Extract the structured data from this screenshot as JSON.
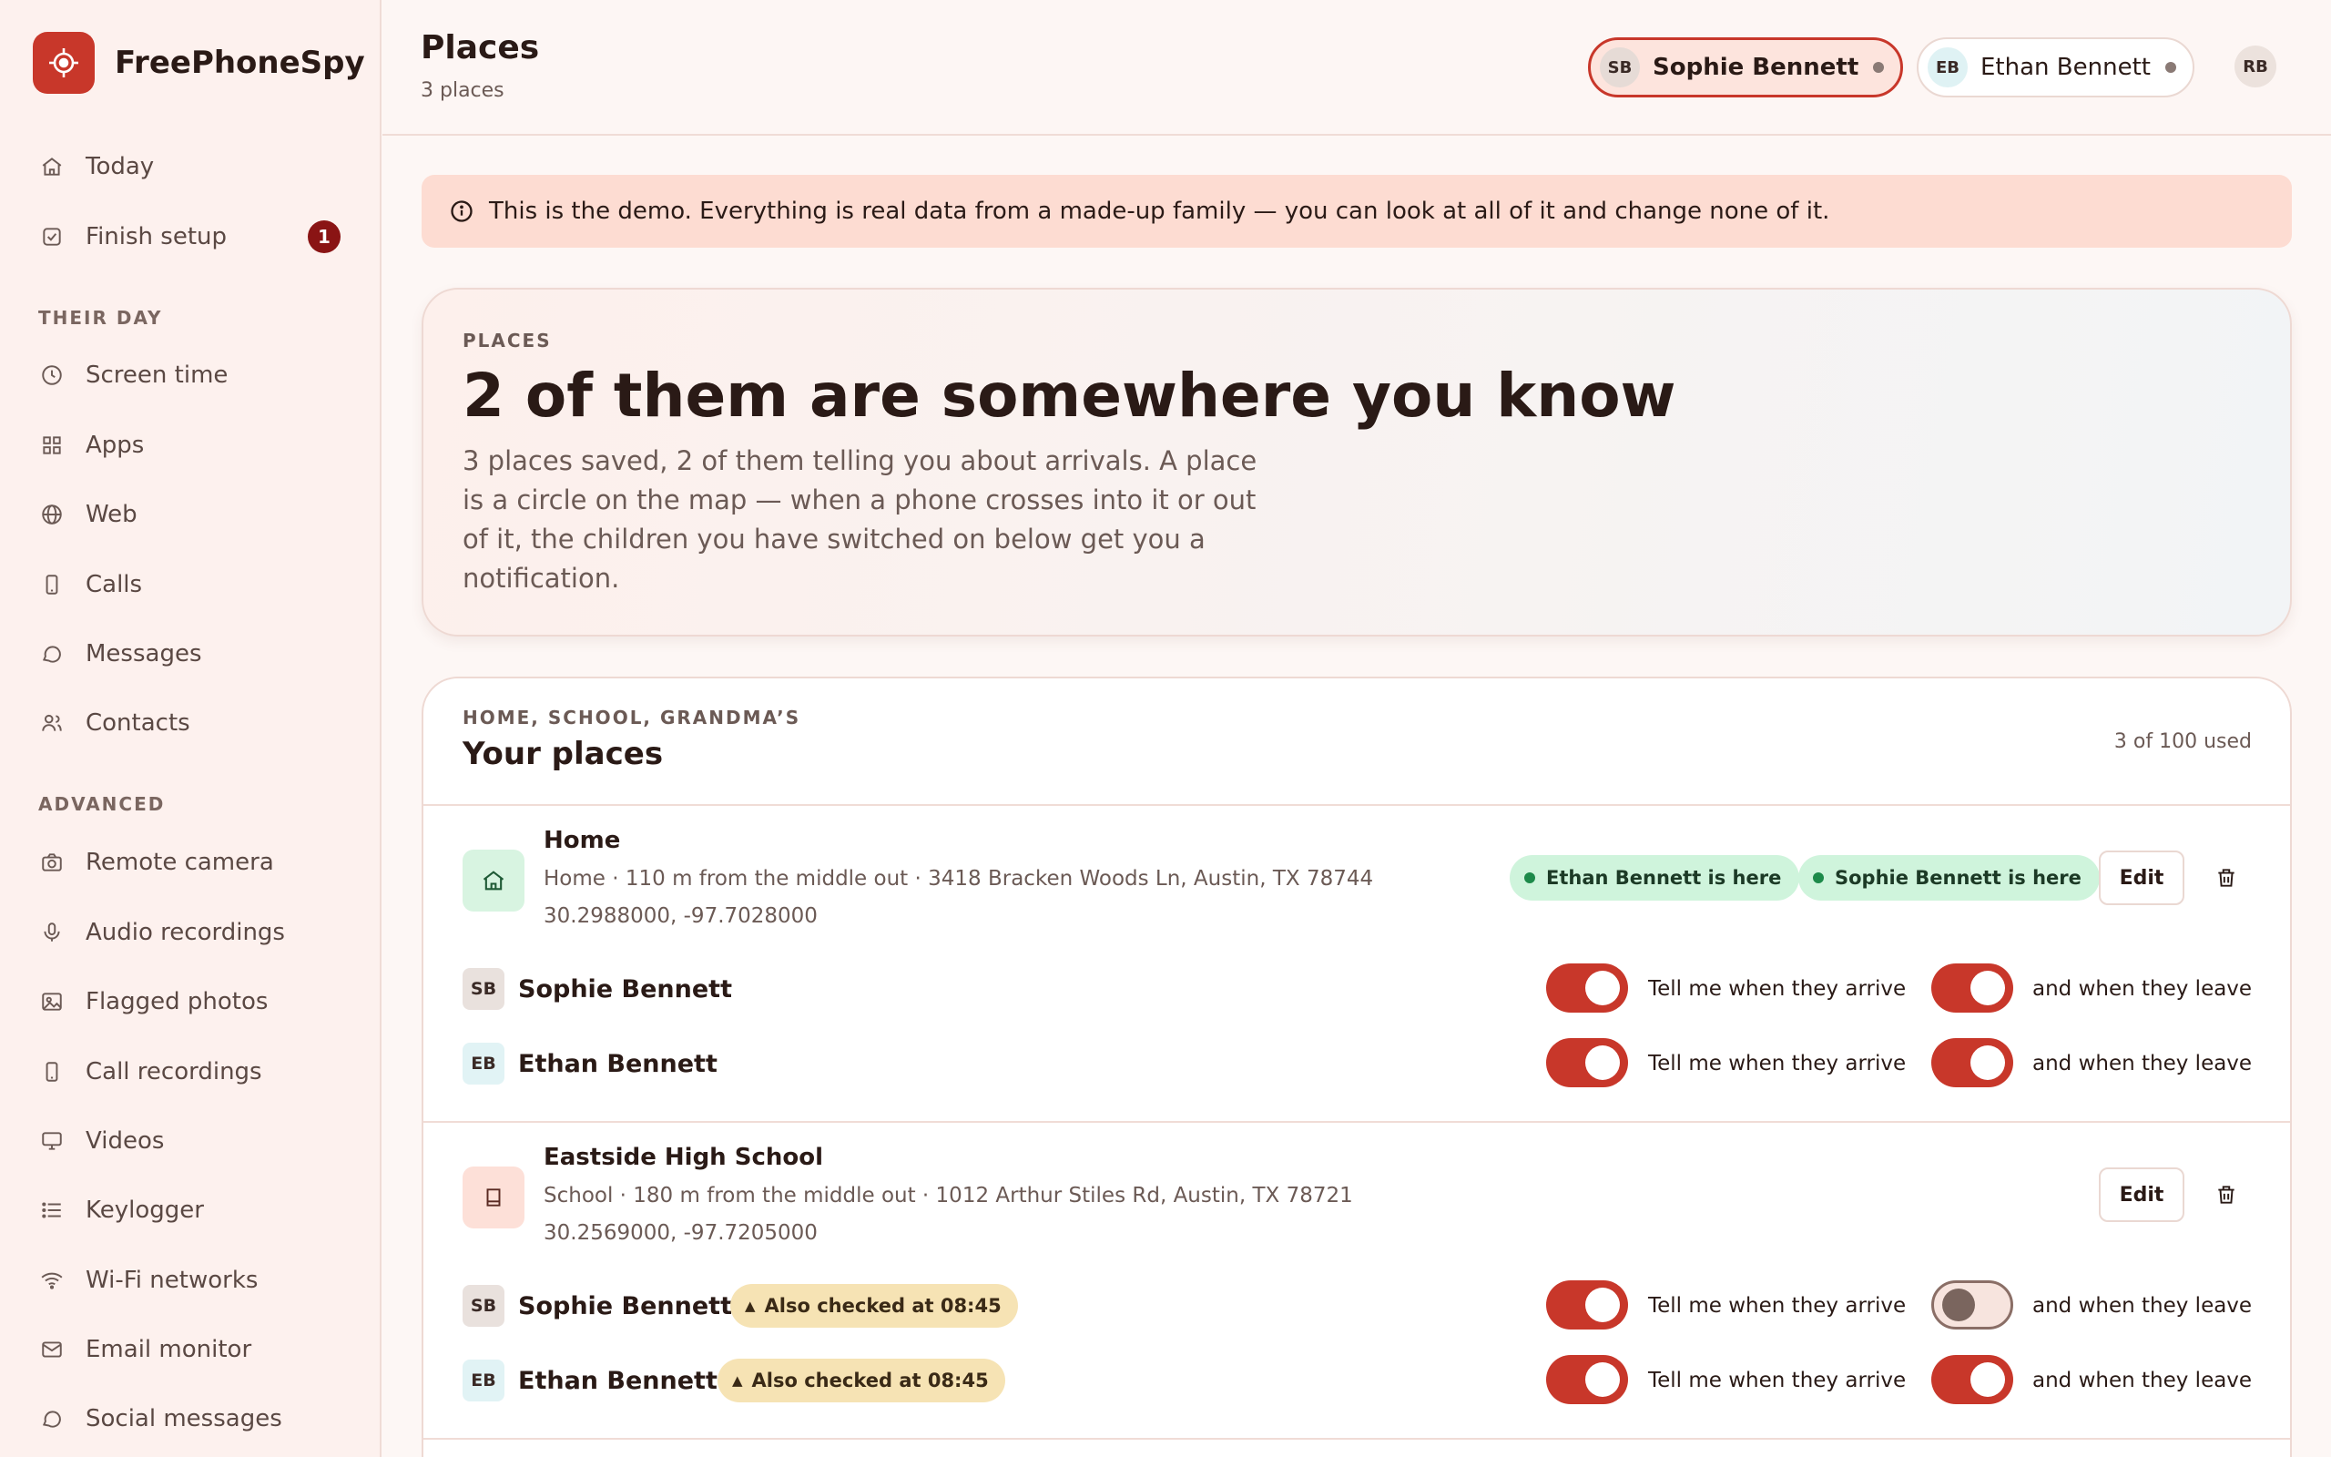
{
  "app": {
    "name": "FreePhoneSpy"
  },
  "sidebar": {
    "items": [
      {
        "label": "Today",
        "icon": "home-icon"
      },
      {
        "label": "Finish setup",
        "icon": "checkbox-icon",
        "badge": "1"
      }
    ],
    "sections": [
      {
        "title": "THEIR DAY",
        "items": [
          {
            "label": "Screen time",
            "icon": "clock-icon"
          },
          {
            "label": "Apps",
            "icon": "grid-icon"
          },
          {
            "label": "Web",
            "icon": "globe-icon"
          },
          {
            "label": "Calls",
            "icon": "phone-icon"
          },
          {
            "label": "Messages",
            "icon": "chat-bubble-icon"
          },
          {
            "label": "Contacts",
            "icon": "users-icon"
          }
        ]
      },
      {
        "title": "ADVANCED",
        "items": [
          {
            "label": "Remote camera",
            "icon": "camera-icon"
          },
          {
            "label": "Audio recordings",
            "icon": "microphone-icon"
          },
          {
            "label": "Flagged photos",
            "icon": "image-icon"
          },
          {
            "label": "Call recordings",
            "icon": "phone-icon"
          },
          {
            "label": "Videos",
            "icon": "monitor-icon"
          },
          {
            "label": "Keylogger",
            "icon": "list-icon"
          },
          {
            "label": "Wi-Fi networks",
            "icon": "wifi-icon"
          },
          {
            "label": "Email monitor",
            "icon": "mail-icon"
          },
          {
            "label": "Social messages",
            "icon": "chat-bubble-icon"
          }
        ]
      }
    ]
  },
  "header": {
    "title": "Places",
    "subtitle": "3 places",
    "children": [
      {
        "initials": "SB",
        "name": "Sophie Bennett",
        "active": true
      },
      {
        "initials": "EB",
        "name": "Ethan Bennett",
        "active": false
      }
    ],
    "user_initials": "RB"
  },
  "banner": {
    "icon": "info-icon",
    "text": "This is the demo. Everything is real data from a made-up family — you can look at all of it and change none of it."
  },
  "hero": {
    "eyebrow": "PLACES",
    "title": "2 of them are somewhere you know",
    "description": "3 places saved, 2 of them telling you about arrivals. A place is a circle on the map — when a phone crosses into it or out of it, the children you have switched on below get you a notification."
  },
  "places_card": {
    "eyebrow": "HOME, SCHOOL, GRANDMA’S",
    "title": "Your places",
    "used": "3 of 100 used",
    "edit_label": "Edit",
    "arrive_label": "Tell me when they arrive",
    "leave_label": "and when they leave",
    "places": [
      {
        "name": "Home",
        "icon": "home-icon",
        "meta": "Home · 110 m from the middle out · 3418 Bracken Woods Ln, Austin, TX 78744",
        "coords": "30.2988000, -97.7028000",
        "present": [
          "Ethan Bennett is here",
          "Sophie Bennett is here"
        ],
        "children": [
          {
            "initials": "SB",
            "name": "Sophie Bennett",
            "arrive": true,
            "leave": true
          },
          {
            "initials": "EB",
            "name": "Ethan Bennett",
            "arrive": true,
            "leave": true
          }
        ]
      },
      {
        "name": "Eastside High School",
        "icon": "book-icon",
        "meta": "School · 180 m from the middle out · 1012 Arthur Stiles Rd, Austin, TX 78721",
        "coords": "30.2569000, -97.7205000",
        "present": [],
        "children": [
          {
            "initials": "SB",
            "name": "Sophie Bennett",
            "warning": "Also checked at 08:45",
            "arrive": true,
            "leave": false
          },
          {
            "initials": "EB",
            "name": "Ethan Bennett",
            "warning": "Also checked at 08:45",
            "arrive": true,
            "leave": true
          }
        ]
      }
    ]
  },
  "colors": {
    "accent": "#c8372a",
    "badge": "#8a1414",
    "present_bg": "#cff4dc",
    "warning_bg": "#f6e3b4",
    "banner_bg": "#fddcd2"
  }
}
